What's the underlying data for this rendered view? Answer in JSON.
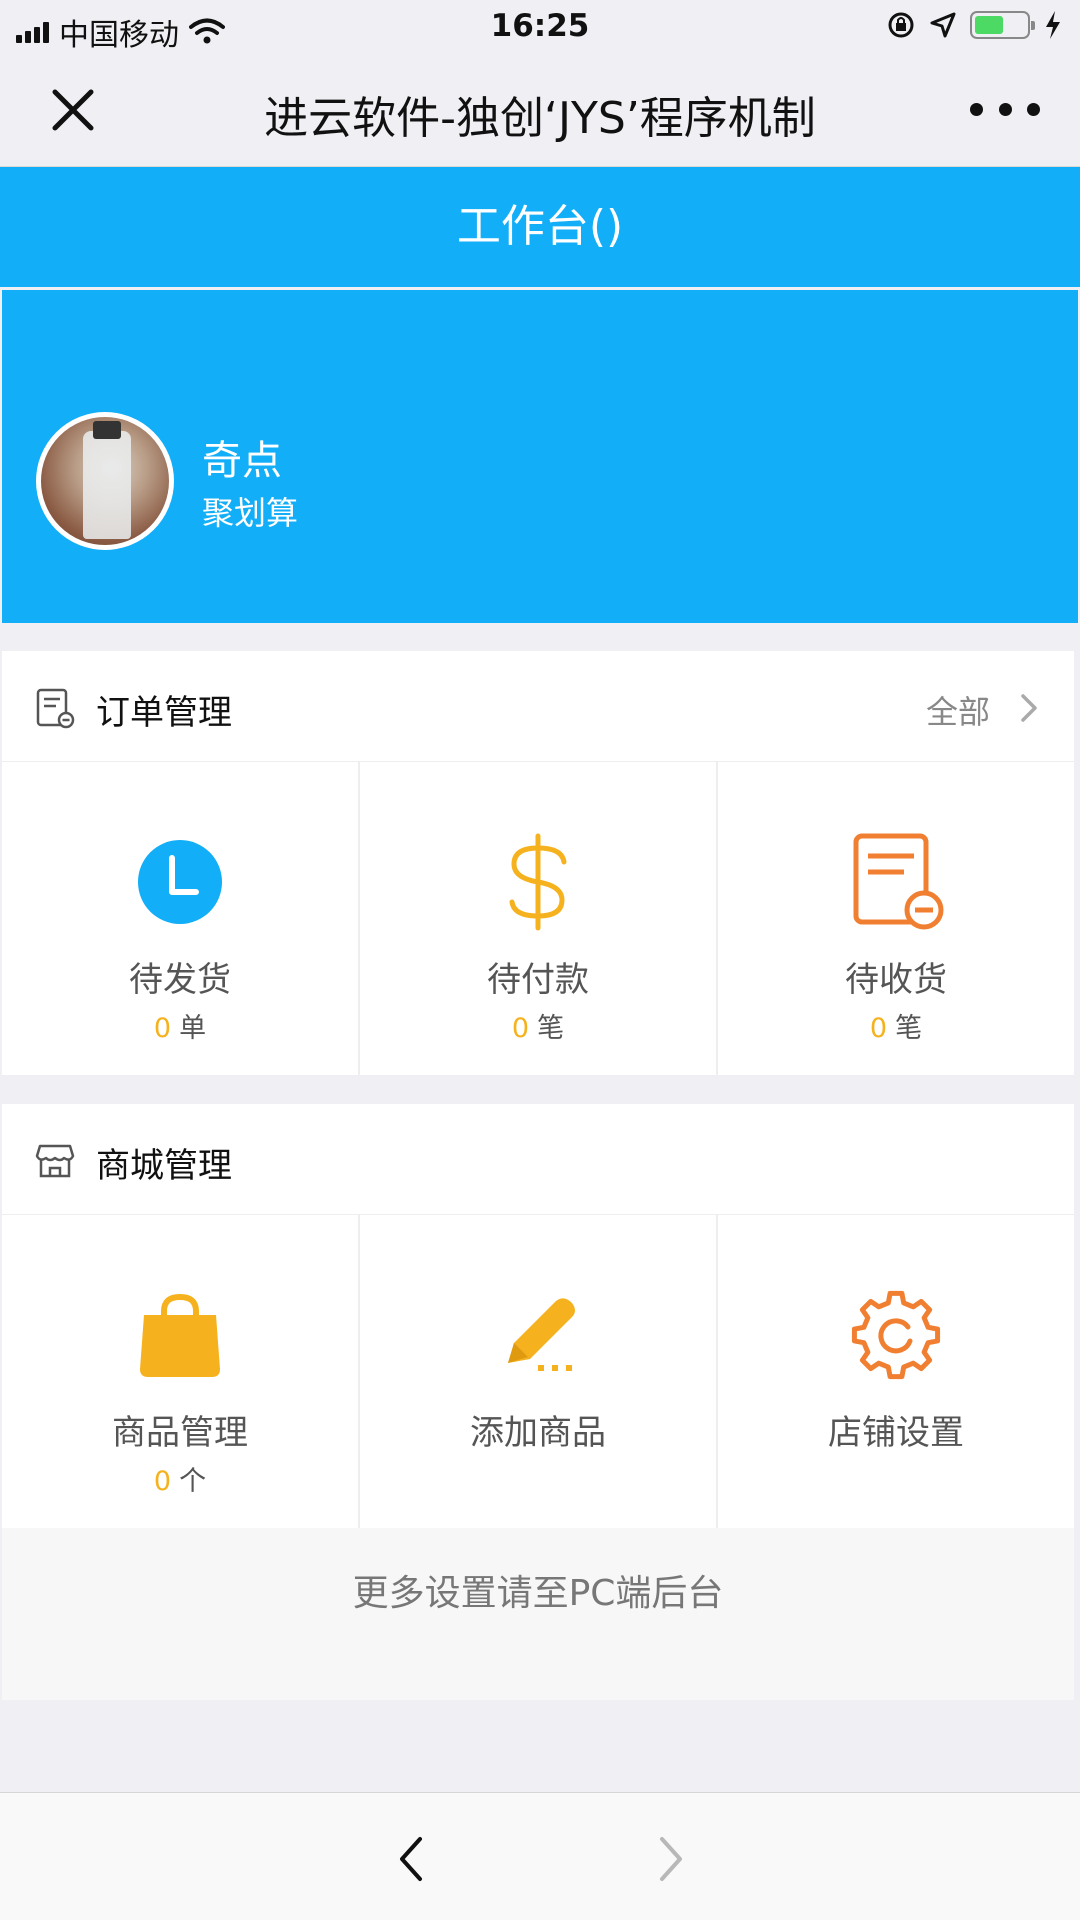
{
  "status_bar": {
    "carrier": "中国移动",
    "time": "16:25",
    "battery_level": 0.55,
    "battery_color": "#4cd964"
  },
  "nav": {
    "title": "进云软件-独创‘JYS’程序机制",
    "close_icon": "close-icon",
    "more_icon": "more-dots-icon"
  },
  "header": {
    "title": "工作台()",
    "color": "#12aef7"
  },
  "profile": {
    "name": "奇点",
    "subtitle": "聚划算"
  },
  "order_section": {
    "title": "订单管理",
    "all_label": "全部",
    "items": [
      {
        "icon": "clock-icon",
        "label": "待发货",
        "count": "0",
        "unit": "单"
      },
      {
        "icon": "dollar-icon",
        "label": "待付款",
        "count": "0",
        "unit": "笔"
      },
      {
        "icon": "receipt-icon",
        "label": "待收货",
        "count": "0",
        "unit": "笔"
      }
    ]
  },
  "shop_section": {
    "title": "商城管理",
    "items": [
      {
        "icon": "shopping-bag-icon",
        "label": "商品管理",
        "count": "0",
        "unit": "个"
      },
      {
        "icon": "pencil-icon",
        "label": "添加商品"
      },
      {
        "icon": "gear-icon",
        "label": "店铺设置"
      }
    ]
  },
  "footer_note": "更多设置请至PC端后台",
  "colors": {
    "accent": "#12aef7",
    "count": "#f5b21e",
    "orange": "#f07f32"
  }
}
